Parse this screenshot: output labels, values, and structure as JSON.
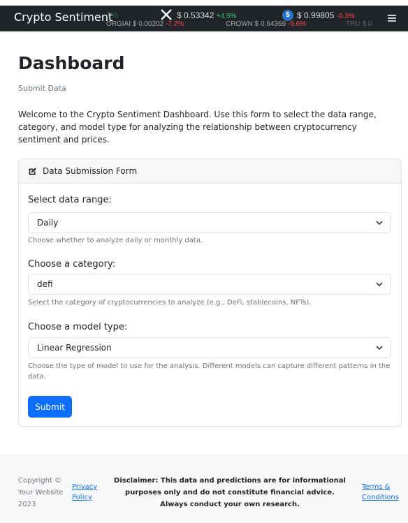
{
  "navbar": {
    "brand": "Crypto Sentiment",
    "ticker_row1": [
      {
        "price": "",
        "change": "1%",
        "change_type": "positive",
        "faded": true
      },
      {
        "price": "$ 0.53342",
        "change": "+4.5%",
        "change_type": "positive",
        "icon": "x-logo-icon"
      },
      {
        "price": "$ 0.99805",
        "change": "-0.3%",
        "change_type": "negative",
        "icon": "usdc-logo-icon"
      }
    ],
    "ticker_row2": [
      {
        "price": "ORGIAI $ 0.00202",
        "change": "-7.2%",
        "change_type": "negative"
      },
      {
        "price": "CROWN $ 0.64369",
        "change": "-9.6%",
        "change_type": "negative"
      },
      {
        "price": "TRU $ 0",
        "change": "",
        "change_type": "negative",
        "faded": true
      }
    ],
    "usdc_glyph": "$",
    "menu_icon": "hamburger-menu-icon"
  },
  "page": {
    "title": "Dashboard",
    "subtitle": "Submit Data",
    "intro": "Welcome to the Crypto Sentiment Dashboard. Use this form to select the data range, category, and model type for analyzing the relationship between cryptocurrency sentiment and prices."
  },
  "form": {
    "header": "Data Submission Form",
    "header_icon": "edit-icon",
    "fields": [
      {
        "label": "Select data range:",
        "value": "Daily",
        "help": "Choose whether to analyze daily or monthly data."
      },
      {
        "label": "Choose a category:",
        "value": "defi",
        "help": "Select the category of cryptocurrencies to analyze (e.g., DeFi, stablecoins, NFTs)."
      },
      {
        "label": "Choose a model type:",
        "value": "Linear Regression",
        "help": "Choose the type of model to use for the analysis. Different models can capture different patterns in the data."
      }
    ],
    "submit_label": "Submit"
  },
  "footer": {
    "copyright": "Copyright © Your Website 2023",
    "privacy_link": "Privacy Policy",
    "disclaimer": "Disclaimer: This data and predictions are for informational purposes only and do not constitute financial advice. Always conduct your own research.",
    "terms_link": "Terms & Conditions"
  },
  "colors": {
    "navbar_bg": "#212529",
    "primary": "#0d6efd",
    "positive": "#2ecc71",
    "negative": "#ff4545",
    "muted": "#6c757d"
  }
}
